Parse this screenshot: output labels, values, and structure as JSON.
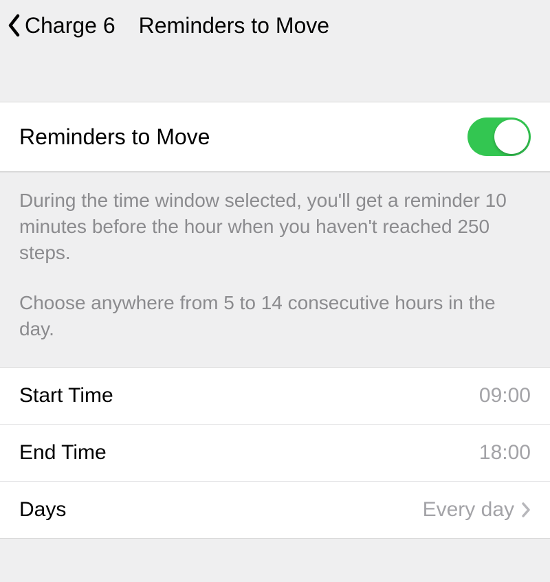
{
  "header": {
    "back_label": "Charge 6",
    "title": "Reminders to Move"
  },
  "toggle": {
    "label": "Reminders to Move",
    "enabled": true
  },
  "description": {
    "p1": "During the time window selected, you'll get a reminder 10 minutes before the hour when you haven't reached 250 steps.",
    "p2": "Choose anywhere from 5 to 14 consecutive hours in the day."
  },
  "rows": {
    "start_time": {
      "label": "Start Time",
      "value": "09:00"
    },
    "end_time": {
      "label": "End Time",
      "value": "18:00"
    },
    "days": {
      "label": "Days",
      "value": "Every day"
    }
  },
  "colors": {
    "toggle_on": "#33c651",
    "secondary_text": "#8b8b8e"
  }
}
